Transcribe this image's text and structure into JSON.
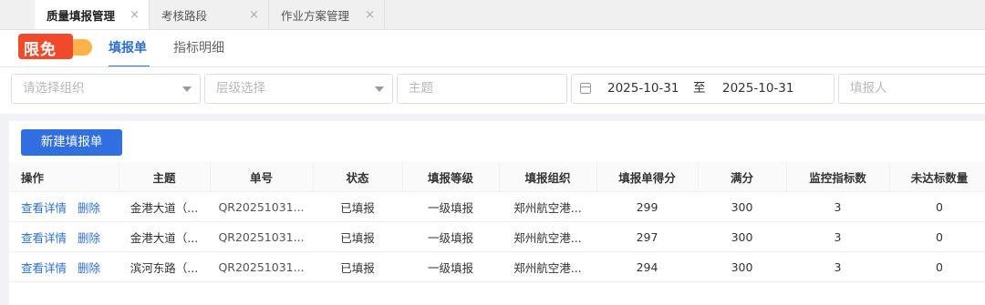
{
  "tabs": [
    {
      "label": "质量填报管理",
      "close": "×"
    },
    {
      "label": "考核路段",
      "close": "×"
    },
    {
      "label": "作业方案管理",
      "close": "×"
    }
  ],
  "promo_badge": "限免",
  "sub_tabs": [
    "填报单",
    "指标明细"
  ],
  "filters": {
    "org_placeholder": "请选择组织",
    "level_placeholder": "层级选择",
    "subject_placeholder": "主题",
    "date_start": "2025-10-31",
    "date_separator": "至",
    "date_end": "2025-10-31",
    "reporter_placeholder": "填报人"
  },
  "toolbar": {
    "new_label": "新建填报单"
  },
  "table": {
    "headers": [
      "操作",
      "主题",
      "单号",
      "状态",
      "填报等级",
      "填报组织",
      "填报单得分",
      "满分",
      "监控指标数",
      "未达标数量"
    ],
    "actions": {
      "view": "查看详情",
      "delete": "删除"
    },
    "rows": [
      {
        "subject": "金港大道（...",
        "number": "QR20251031...",
        "status": "已填报",
        "level": "一级填报",
        "org": "郑州航空港...",
        "score": "299",
        "full": "300",
        "monitor": "3",
        "unmet": "0"
      },
      {
        "subject": "金港大道（...",
        "number": "QR20251031...",
        "status": "已填报",
        "level": "一级填报",
        "org": "郑州航空港...",
        "score": "297",
        "full": "300",
        "monitor": "3",
        "unmet": "0"
      },
      {
        "subject": "滨河东路（...",
        "number": "QR20251031...",
        "status": "已填报",
        "level": "一级填报",
        "org": "郑州航空港...",
        "score": "294",
        "full": "300",
        "monitor": "3",
        "unmet": "0"
      }
    ]
  }
}
